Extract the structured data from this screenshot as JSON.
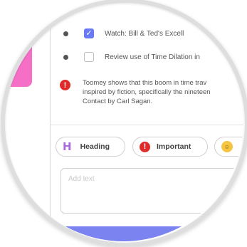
{
  "tasks": [
    {
      "label": "Watch: Bill & Ted's Excell",
      "checked": true
    },
    {
      "label": "Review use of Time Dilation in",
      "checked": false
    }
  ],
  "note": {
    "lines": [
      "Toomey shows that this boom in time trav",
      "inspired by fiction, specifically the nineteen",
      "Contact by Carl Sagan."
    ]
  },
  "toolbar": {
    "heading_label": "Heading",
    "important_label": "Important"
  },
  "editor": {
    "placeholder": "Add text"
  },
  "colors": {
    "accent": "#6a7af5",
    "alert": "#e02b2b",
    "heading_icon": "#a86ae0",
    "pink_strip": "#f56fc7",
    "bottom_bar": "#7a83f0"
  },
  "icons": {
    "check": "check-icon",
    "alert": "exclamation-circle-icon",
    "heading": "heading-h-icon",
    "emoji": "emoji-icon"
  }
}
